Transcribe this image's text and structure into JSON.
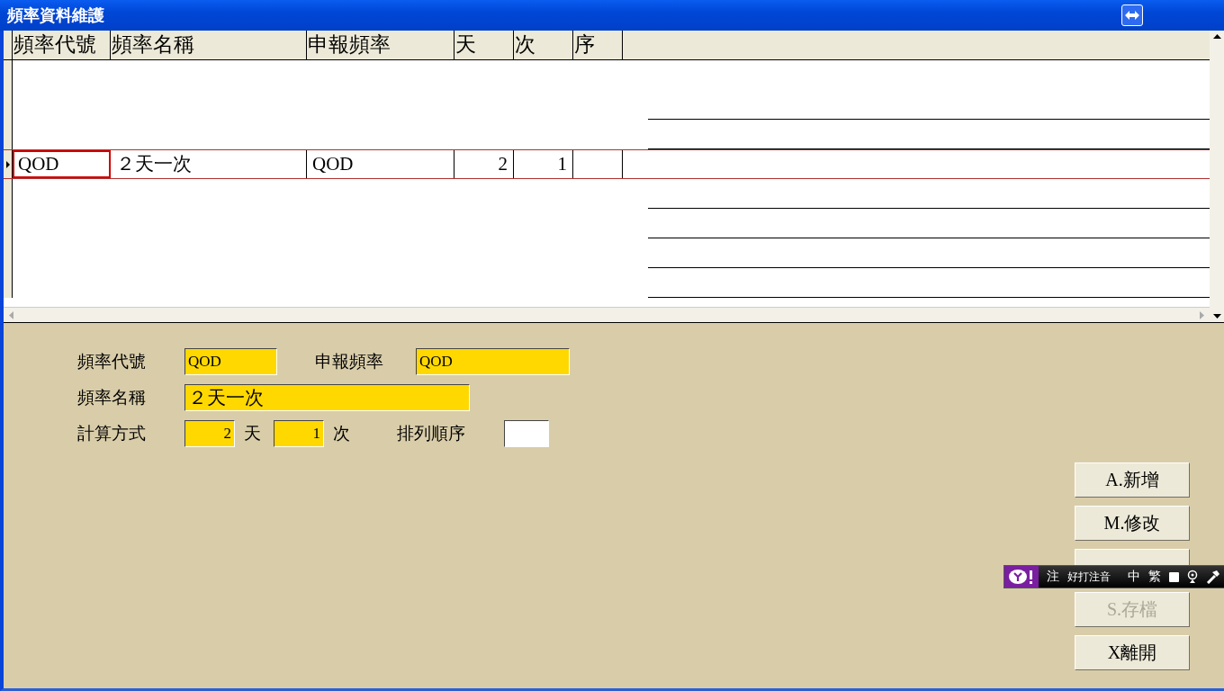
{
  "window": {
    "title": "頻率資料維護"
  },
  "grid": {
    "columns": [
      {
        "label": "頻率代號",
        "kind": "text"
      },
      {
        "label": "頻率名稱",
        "kind": "text"
      },
      {
        "label": "申報頻率",
        "kind": "text"
      },
      {
        "label": "天",
        "kind": "number"
      },
      {
        "label": "次",
        "kind": "number"
      },
      {
        "label": "序",
        "kind": "number"
      }
    ],
    "rows": [
      {
        "current": true,
        "cells": [
          "QOD",
          "２天一次",
          "QOD",
          "2",
          "1",
          ""
        ]
      }
    ]
  },
  "form": {
    "code": {
      "label": "頻率代號",
      "value": "QOD"
    },
    "report": {
      "label": "申報頻率",
      "value": "QOD"
    },
    "name": {
      "label": "頻率名稱",
      "value": "２天一次"
    },
    "calc": {
      "label": "計算方式",
      "days": "2",
      "days_unit": "天",
      "times": "1",
      "times_unit": "次"
    },
    "order": {
      "label": "排列順序"
    }
  },
  "buttons": [
    {
      "label": "A.新增",
      "disabled": false
    },
    {
      "label": "M.修改",
      "disabled": false
    },
    {
      "covered": true,
      "disabled": false
    },
    {
      "label": "S.存檔",
      "disabled": true
    },
    {
      "label": "X離開",
      "disabled": false
    }
  ],
  "ime_bar": {
    "items": [
      "注",
      "好打注音",
      "中",
      "繁"
    ]
  }
}
